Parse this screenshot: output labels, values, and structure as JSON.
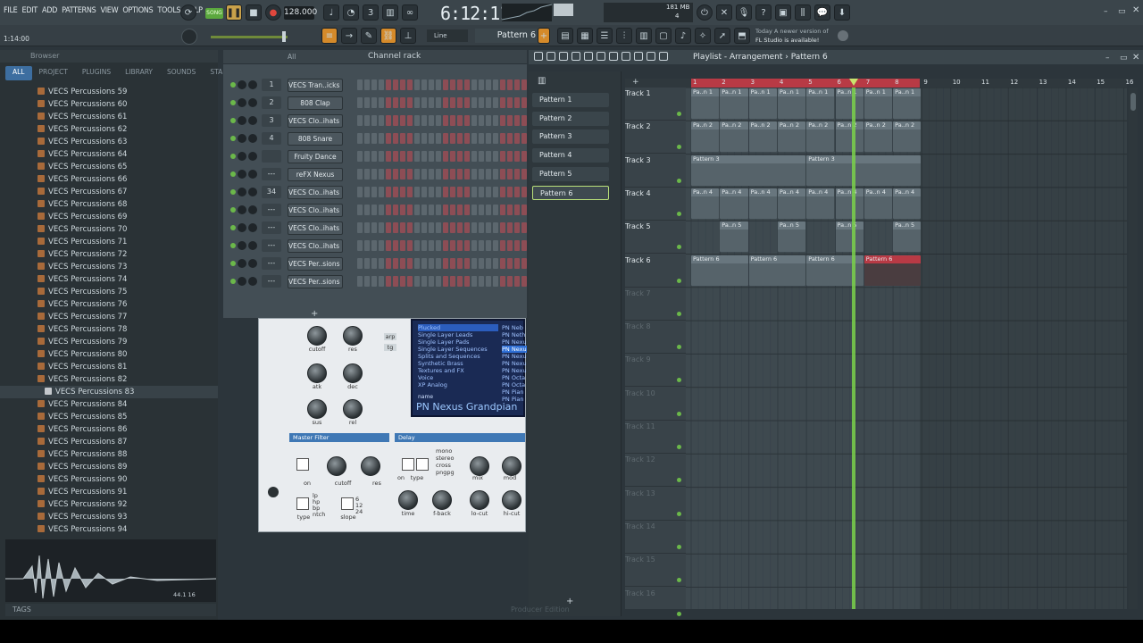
{
  "menu": [
    "FILE",
    "EDIT",
    "ADD",
    "PATTERNS",
    "VIEW",
    "OPTIONS",
    "TOOLS",
    "HELP"
  ],
  "transport": {
    "mode": "SONG",
    "tempo": "128.000",
    "time": "6:12:11",
    "memory": "181 MB",
    "cpu": "4",
    "hint_time": "1:14:00",
    "snap": "Line",
    "pattern": "Pattern 6"
  },
  "news": {
    "line1": "Today  A newer version of",
    "line2": "FL Studio is available!"
  },
  "browser": {
    "title": "Browser",
    "tabs": [
      "ALL",
      "PROJECT",
      "PLUGINS",
      "LIBRARY",
      "SOUNDS",
      "STARRED"
    ],
    "items": [
      "VECS Percussions 59",
      "VECS Percussions 60",
      "VECS Percussions 61",
      "VECS Percussions 62",
      "VECS Percussions 63",
      "VECS Percussions 64",
      "VECS Percussions 65",
      "VECS Percussions 66",
      "VECS Percussions 67",
      "VECS Percussions 68",
      "VECS Percussions 69",
      "VECS Percussions 70",
      "VECS Percussions 71",
      "VECS Percussions 72",
      "VECS Percussions 73",
      "VECS Percussions 74",
      "VECS Percussions 75",
      "VECS Percussions 76",
      "VECS Percussions 77",
      "VECS Percussions 78",
      "VECS Percussions 79",
      "VECS Percussions 80",
      "VECS Percussions 81",
      "VECS Percussions 82",
      "VECS Percussions 83",
      "VECS Percussions 84",
      "VECS Percussions 85",
      "VECS Percussions 86",
      "VECS Percussions 87",
      "VECS Percussions 88",
      "VECS Percussions 89",
      "VECS Percussions 90",
      "VECS Percussions 91",
      "VECS Percussions 92",
      "VECS Percussions 93",
      "VECS Percussions 94"
    ],
    "selected_index": 24,
    "sample_info": "44.1  16",
    "tags_label": "TAGS"
  },
  "rack": {
    "title": "Channel rack",
    "filter": "All",
    "channels": [
      {
        "num": "1",
        "name": "VECS Tran..icks 50"
      },
      {
        "num": "2",
        "name": "808 Clap"
      },
      {
        "num": "3",
        "name": "VECS Clo..ihats 28"
      },
      {
        "num": "4",
        "name": "808 Snare"
      },
      {
        "num": "",
        "name": "Fruity Dance"
      },
      {
        "num": "---",
        "name": "reFX Nexus"
      },
      {
        "num": "34",
        "name": "VECS Clo..ihats 18"
      },
      {
        "num": "---",
        "name": "VECS Clo..ihats 04"
      },
      {
        "num": "---",
        "name": "VECS Clo..ihats 10"
      },
      {
        "num": "---",
        "name": "VECS Clo..ihats 15"
      },
      {
        "num": "---",
        "name": "VECS Per..sions 55"
      },
      {
        "num": "---",
        "name": "VECS Per..sions 83"
      }
    ]
  },
  "plugin": {
    "categories": [
      "Plucked",
      "Single Layer Leads",
      "Single Layer Pads",
      "Single Layer Sequences",
      "Splits and Sequences",
      "Synthetic Brass",
      "Textures and FX",
      "Voice",
      "XP Analog"
    ],
    "presets": [
      "PN Neb",
      "PN Neth",
      "PN Nexu",
      "PN Nexu",
      "PN Nexu",
      "PN Nexu",
      "PN Nexu",
      "PN Octa",
      "PN Octa",
      "PN Pian",
      "PN Pian"
    ],
    "name_label": "name",
    "preset_name": "PN Nexus Grandpian",
    "knobs_top": [
      "cutoff",
      "res",
      "atk",
      "dec",
      "sus",
      "rel"
    ],
    "side_labels": [
      "arp",
      "tg"
    ],
    "master_filter": "Master Filter",
    "delay": "Delay",
    "mf_labels": [
      "on",
      "cutoff",
      "res",
      "type",
      "slope"
    ],
    "filter_types": [
      "lp",
      "hp",
      "bp",
      "ntch"
    ],
    "slopes": [
      "6",
      "12",
      "24"
    ],
    "delay_modes": [
      "mono",
      "stereo",
      "cross",
      "pngpg"
    ],
    "delay_labels": [
      "on",
      "type",
      "mix",
      "mod",
      "time",
      "f-back",
      "lo-cut",
      "hi-cut"
    ]
  },
  "patterns": [
    "Pattern 1",
    "Pattern 2",
    "Pattern 3",
    "Pattern 4",
    "Pattern 5",
    "Pattern 6"
  ],
  "playlist": {
    "title": "Playlist - Arrangement",
    "pattern": "Pattern 6",
    "tracks": [
      "Track 1",
      "Track 2",
      "Track 3",
      "Track 4",
      "Track 5",
      "Track 6",
      "Track 7",
      "Track 8",
      "Track 9",
      "Track 10",
      "Track 11",
      "Track 12",
      "Track 13",
      "Track 14",
      "Track 15",
      "Track 16"
    ],
    "bars": [
      "1",
      "2",
      "3",
      "4",
      "5",
      "6",
      "7",
      "8",
      "9",
      "10",
      "11",
      "12",
      "13",
      "14",
      "15",
      "16"
    ],
    "clip_short": "Pa..n 1",
    "clip_short2": "Pa..n 2",
    "clip_short4": "Pa..n 4",
    "clip_short5": "Pa..n 5",
    "clip_p3": "Pattern 3",
    "clip_p6": "Pattern 6"
  },
  "footer_text": "Producer Edition",
  "colors": {
    "accent": "#b6e36e",
    "clip_red": "#b83a45",
    "playhead": "#7ad14a"
  }
}
